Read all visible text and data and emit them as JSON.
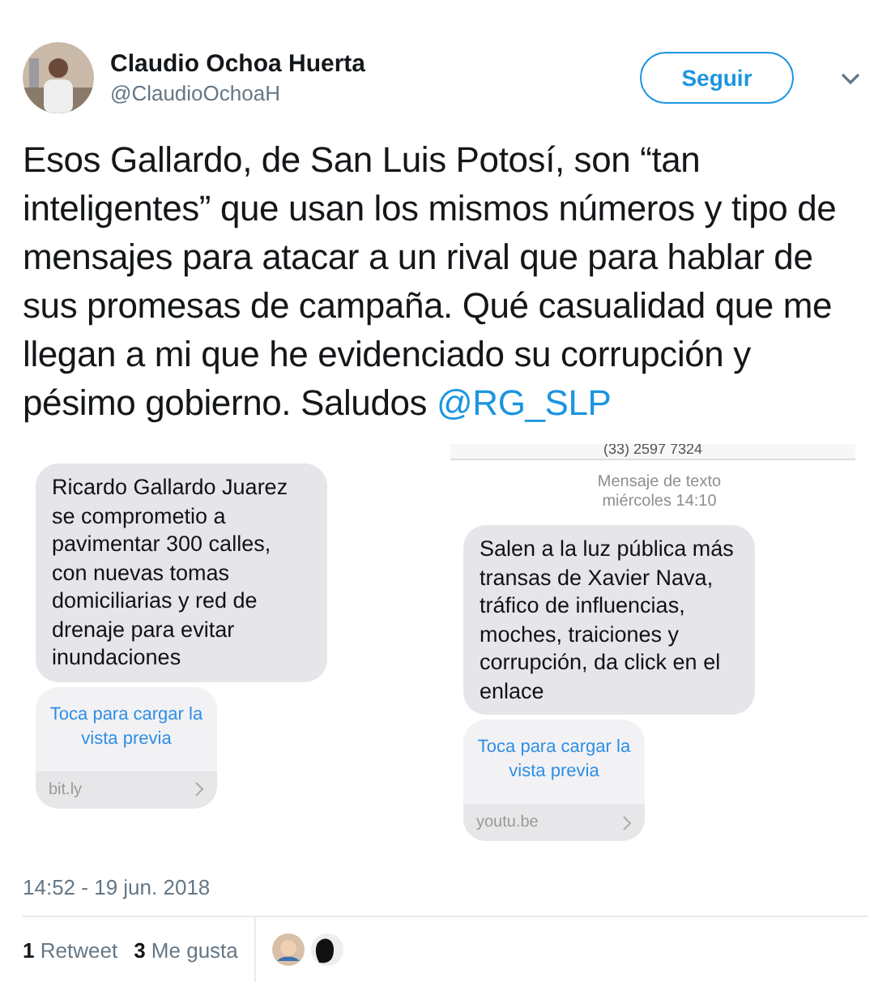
{
  "author": {
    "name": "Claudio Ochoa Huerta",
    "handle": "@ClaudioOchoaH"
  },
  "follow_button": "Seguir",
  "tweet_text": "Esos Gallardo, de San Luis Potosí, son “tan inteligentes” que usan los mismos números y tipo de mensajes para atacar a un rival que para hablar de sus promesas de campaña. Qué casualidad que me llegan a mi que he evidenciado su corrupción y pésimo gobierno. Saludos ",
  "mention": "@RG_SLP",
  "screenshots": [
    {
      "message": "Ricardo Gallardo Juarez se comprometio a pavimentar 300 calles, con nuevas tomas domiciliarias y red de drenaje para evitar inundaciones",
      "preview_link": "Toca para cargar la vista previa",
      "domain": "bit.ly"
    },
    {
      "header": "(33) 2597 7324",
      "meta": [
        "Mensaje de texto",
        "miércoles 14:10"
      ],
      "message": "Salen a la luz pública más transas de Xavier Nava, tráfico de influencias, moches, traiciones y corrupción, da click en el enlace",
      "preview_link": "Toca para cargar la vista previa",
      "domain": "youtu.be"
    }
  ],
  "timestamp": "14:52 - 19 jun. 2018",
  "stats": [
    {
      "count": "1",
      "label": "Retweet"
    },
    {
      "count": "3",
      "label": "Me gusta"
    }
  ]
}
